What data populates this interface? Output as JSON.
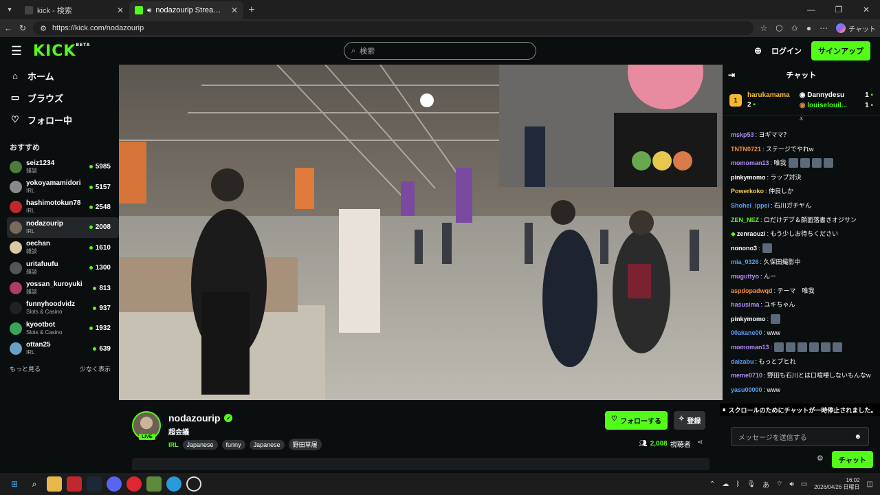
{
  "browser": {
    "tabs": [
      {
        "title": "kick - 検索",
        "active": false
      },
      {
        "title": "nodazourip Stream - Watch Live on Kick",
        "active": true
      }
    ],
    "url": "https://kick.com/nodazourip",
    "copilot_label": "チャット"
  },
  "nav": {
    "logo": "KICK",
    "logo_badge": "BETA",
    "search_placeholder": "検索",
    "login": "ログイン",
    "signup": "サインアップ"
  },
  "sidebar": {
    "nav": [
      {
        "label": "ホーム",
        "icon": "home-icon"
      },
      {
        "label": "ブラウズ",
        "icon": "browse-icon"
      },
      {
        "label": "フォロー中",
        "icon": "heart-icon"
      }
    ],
    "recommended_title": "おすすめ",
    "channels": [
      {
        "name": "seiz1234",
        "category": "雑談",
        "viewers": "5985",
        "color": "#4a7c3a"
      },
      {
        "name": "yokoyamamidori",
        "category": "IRL",
        "viewers": "5157",
        "color": "#8a8a8a"
      },
      {
        "name": "hashimotokun78",
        "category": "IRL",
        "viewers": "2548",
        "color": "#c0282e"
      },
      {
        "name": "nodazourip",
        "category": "IRL",
        "viewers": "2008",
        "color": "#7a6a5a"
      },
      {
        "name": "oechan",
        "category": "雑談",
        "viewers": "1610",
        "color": "#d9c9a8"
      },
      {
        "name": "uritafuufu",
        "category": "雑談",
        "viewers": "1300",
        "color": "#555555"
      },
      {
        "name": "yossan_kuroyuki",
        "category": "雑談",
        "viewers": "813",
        "color": "#b03a6a"
      },
      {
        "name": "funnyhoodvidz",
        "category": "Slots & Casino",
        "viewers": "937",
        "color": "#222222"
      },
      {
        "name": "kyootbot",
        "category": "Slots & Casino",
        "viewers": "1932",
        "color": "#3aa55a"
      },
      {
        "name": "ottan25",
        "category": "IRL",
        "viewers": "639",
        "color": "#6aa0c8"
      }
    ],
    "show_more": "もっと見る",
    "show_less": "少なく表示"
  },
  "stream": {
    "name": "nodazourip",
    "title": "超会議",
    "live_badge": "LIVE",
    "category": "IRL",
    "tags": [
      "Japanese",
      "funny",
      "Japanese",
      "野田草履"
    ],
    "follow_label": "フォローする",
    "subscribe_label": "登録",
    "viewer_count": "2,008",
    "viewer_label": "視聴者"
  },
  "chat": {
    "title": "チャット",
    "top_gifters": [
      {
        "name": "harukamama",
        "count": "2"
      },
      {
        "name": "Dannydesu",
        "count": "1"
      },
      {
        "name": "louiselouil...",
        "count": "1"
      }
    ],
    "messages": [
      {
        "user": "mskp53",
        "text": ": ヨギママ？",
        "color": "#b48cf2",
        "emotes": 0
      },
      {
        "user": "TNTN0721",
        "text": ": ステージでやれw",
        "color": "#f28c3c",
        "emotes": 0
      },
      {
        "user": "momoman13",
        "text": ": 唯我",
        "color": "#b48cf2",
        "emotes": 4
      },
      {
        "user": "pinkymomo",
        "text": ": ラップ対決",
        "color": "#ffffff",
        "emotes": 0
      },
      {
        "user": "Powerkoko",
        "text": ": 仲良しか",
        "color": "#f2c94c",
        "emotes": 0
      },
      {
        "user": "Shohei_ippei",
        "text": ": 石川ガチヤん",
        "color": "#5aa0f2",
        "emotes": 0
      },
      {
        "user": "ZEN_NEZ",
        "text": ": ロだけデブ＆顔面落書きオジサン",
        "color": "#53fc18",
        "emotes": 0
      },
      {
        "user": "zenraouzi",
        "text": ": もう少しお待ちください",
        "color": "#ffffff",
        "emotes": 0
      },
      {
        "user": "nonono3",
        "text": ":",
        "color": "#ffffff",
        "emotes": 1
      },
      {
        "user": "mia_0326",
        "text": ": 久保田撮影中",
        "color": "#5aa0f2",
        "emotes": 0
      },
      {
        "user": "muguttyo",
        "text": ": んー",
        "color": "#b48cf2",
        "emotes": 0
      },
      {
        "user": "aspdopadwqd",
        "text": ": テーマ　唯我",
        "color": "#f28c3c",
        "emotes": 0
      },
      {
        "user": "hasusima",
        "text": ": ユキちゃん",
        "color": "#b48cf2",
        "emotes": 0
      },
      {
        "user": "pinkymomo",
        "text": ":",
        "color": "#ffffff",
        "emotes": 1
      },
      {
        "user": "00akane00",
        "text": ": www",
        "color": "#5aa0f2",
        "emotes": 0
      },
      {
        "user": "momoman13",
        "text": ":",
        "color": "#b48cf2",
        "emotes": 6
      },
      {
        "user": "daizabu",
        "text": ": もっとブヒれ",
        "color": "#5aa0f2",
        "emotes": 0
      },
      {
        "user": "meme0710",
        "text": ": 野田も石川とは口喧嘩しないもんなw",
        "color": "#b48cf2",
        "emotes": 0
      },
      {
        "user": "yasu00000",
        "text": ": www",
        "color": "#5aa0f2",
        "emotes": 0
      }
    ],
    "paused_notice": "スクロールのためにチャットが一時停止されました。",
    "input_placeholder": "メッセージを送信する",
    "send_label": "チャット"
  },
  "taskbar": {
    "time": "16:02",
    "date": "2026/04/26 日曜日",
    "ime": "あ"
  }
}
